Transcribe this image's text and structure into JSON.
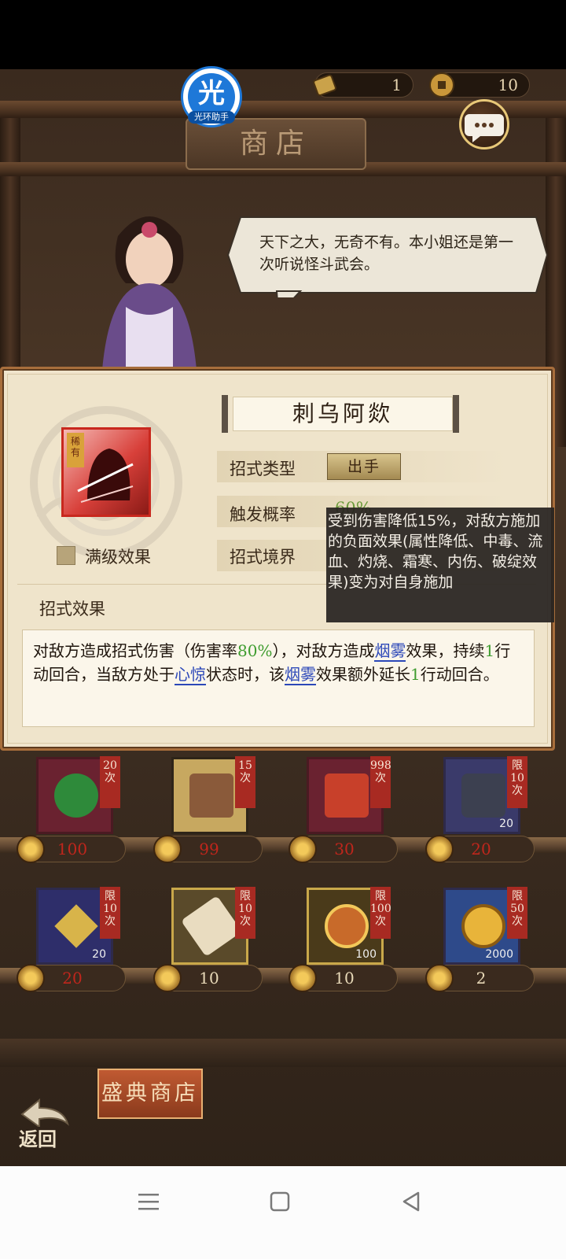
{
  "status_bar": {},
  "top_bar": {
    "assistant": {
      "glyph": "光",
      "label": "光环助手",
      "icon": "halo-assistant-icon"
    },
    "resources": [
      {
        "icon": "token-icon",
        "value": "1"
      },
      {
        "icon": "coin-icon",
        "value": "10"
      }
    ],
    "chat_icon": "chat-bubble-icon"
  },
  "shop": {
    "title": "商店"
  },
  "npc": {
    "speech": "天下之大，无奇不有。本小姐还是第一次听说怪斗武会。"
  },
  "skill_panel": {
    "name": "刺乌阿欻",
    "rarity_tag": "稀有",
    "full_level_label": "满级效果",
    "type_label": "招式类型",
    "type_value": "出手",
    "trigger_label": "触发概率",
    "trigger_value": "60%",
    "realm_label": "招式境界",
    "effect_title": "招式效果",
    "description": {
      "p1": "对敌方造成招式伤害（伤害率",
      "rate": "80%",
      "p2": "），对敌方造成",
      "kw1": "烟雾",
      "p3": "效果，持续",
      "n1": "1",
      "p4": "行动回合，当敌方处于",
      "kw2": "心惊",
      "p5": "状态时，该",
      "kw3": "烟雾",
      "p6": "效果额外延长",
      "n2": "1",
      "p7": "行动回合。"
    },
    "tooltip": "受到伤害降低15%，对敌方施加的负面效果(属性降低、中毒、流血、灼烧、霜寒、内伤、破绽效果)变为对自身施加"
  },
  "items_row1": [
    {
      "limit": "20次",
      "price": "100",
      "icon": "jade-icon"
    },
    {
      "limit": "15次",
      "price": "99",
      "icon": "chest-icon"
    },
    {
      "limit": "998次",
      "price": "30",
      "icon": "giftbox-icon"
    },
    {
      "limit": "限10次",
      "count": "20",
      "price": "20",
      "icon": "ore-icon"
    }
  ],
  "items_row2": [
    {
      "limit": "限10次",
      "count": "20",
      "price": "20",
      "icon": "shuriken-icon"
    },
    {
      "limit": "限10次",
      "price": "10",
      "icon": "scroll-icon"
    },
    {
      "limit": "限100次",
      "count": "100",
      "price": "10",
      "icon": "medallion-icon"
    },
    {
      "limit": "限50次",
      "count": "2000",
      "price": "2",
      "icon": "copper-coin-icon"
    }
  ],
  "bottom": {
    "festival_shop": "盛典商店",
    "back": "返回"
  },
  "navbar": {
    "menu_icon": "menu-icon",
    "home_icon": "home-icon",
    "back_icon": "back-triangle-icon"
  }
}
